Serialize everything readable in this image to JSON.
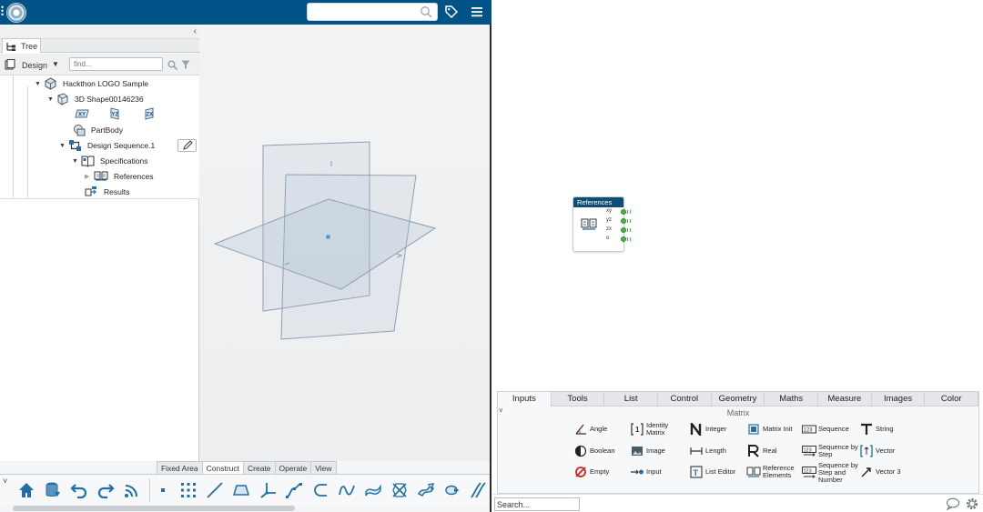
{
  "left_app": {
    "top_search": {
      "value": ""
    },
    "tree_tab_label": "Tree",
    "design_label": "Design",
    "find_placeholder": "find...",
    "tree_nodes": [
      {
        "label": "Hackthon LOGO Sample",
        "icon": "product-icon"
      },
      {
        "label": "3D Shape00146236",
        "icon": "shape-icon"
      },
      {
        "label": "PartBody",
        "icon": "partbody-icon"
      },
      {
        "label": "Design Sequence.1",
        "icon": "design-sequence-icon"
      },
      {
        "label": "Specifications",
        "icon": "specifications-icon"
      },
      {
        "label": "References",
        "icon": "references-icon"
      },
      {
        "label": "Results",
        "icon": "results-icon"
      }
    ],
    "plane_icons": [
      "XY",
      "YZ",
      "ZX"
    ],
    "toolbar_tabs": [
      "Fixed Area",
      "Construct",
      "Create",
      "Operate",
      "View"
    ],
    "active_toolbar_tab": "Construct",
    "toolbar_left_icons": [
      "home-icon",
      "database-icon",
      "undo-icon",
      "redo-icon",
      "broadcast-icon"
    ],
    "toolbar_right_icons": [
      "point-icon",
      "point-grid-icon",
      "line-icon",
      "plane-icon",
      "axis-system-icon",
      "spline-icon",
      "arc-icon",
      "curve-icon",
      "sweep-icon",
      "transform-icon",
      "surface-icon",
      "wrap-icon",
      "parallel-curves-icon"
    ]
  },
  "right_app": {
    "node": {
      "title": "References",
      "ports": [
        "xy",
        "yz",
        "zx",
        "o"
      ]
    },
    "library_tabs": [
      "Inputs",
      "Tools",
      "List",
      "Control",
      "Geometry",
      "Maths",
      "Measure",
      "Images",
      "Color"
    ],
    "active_library_tab": "Inputs",
    "library_subtitle": "Matrix",
    "library_items": [
      [
        "Angle",
        "Identity Matrix",
        "Integer",
        "Matrix Init",
        "Sequence",
        "String"
      ],
      [
        "Boolean",
        "Image",
        "Length",
        "Real",
        "Sequence by Step",
        "Vector"
      ],
      [
        "Empty",
        "Input",
        "List Editor",
        "Reference Elements",
        "Sequence by Step and Number",
        "Vector 3"
      ]
    ],
    "search_value": "Search..."
  },
  "colors": {
    "topbar": "#005386",
    "node_header": "#0f4e74",
    "port_green": "#4bb543",
    "toolbar_icon_blue": "#1f6fa8"
  }
}
